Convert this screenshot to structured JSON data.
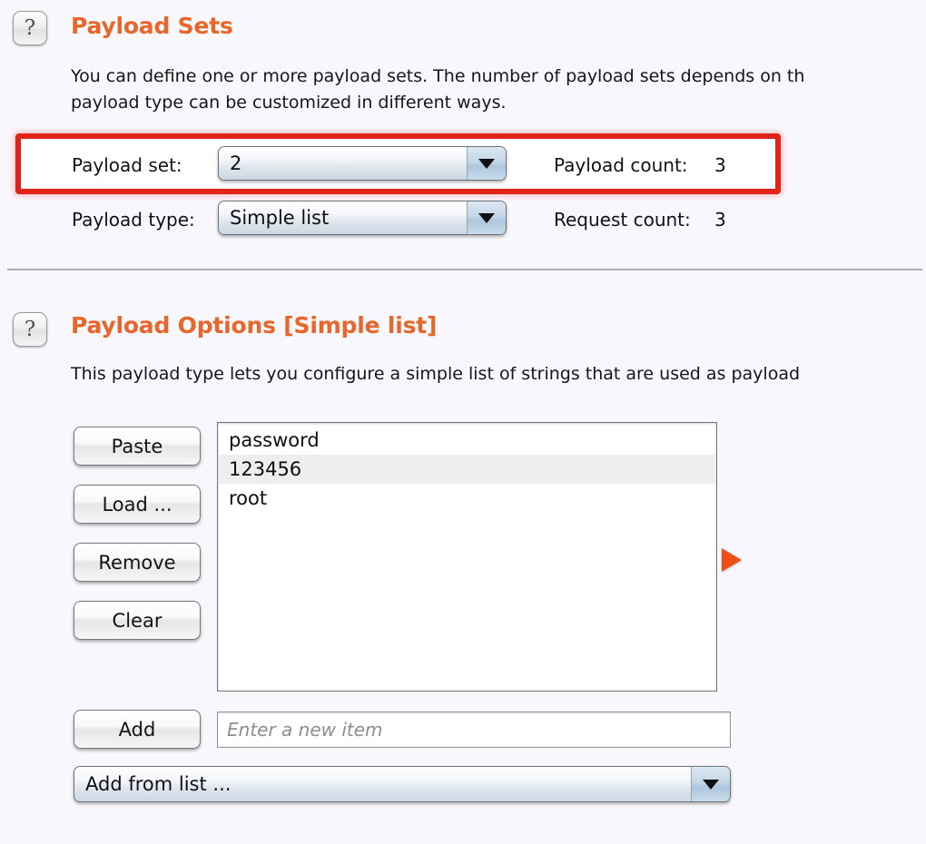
{
  "page": {
    "background": "#f8f7fb",
    "accent_color": "#e8652b",
    "annotation_color": "#e2231a"
  },
  "payload_sets": {
    "help_icon": "question-mark-icon",
    "title": "Payload Sets",
    "description_line1": "You can define one or more payload sets. The number of payload sets depends on th",
    "description_line2": "payload type can be customized in different ways.",
    "payload_set": {
      "label": "Payload set:",
      "value": "2",
      "arrow_icon": "chevron-down-icon"
    },
    "payload_type": {
      "label": "Payload type:",
      "value": "Simple list",
      "arrow_icon": "chevron-down-icon"
    },
    "payload_count": {
      "label": "Payload count:",
      "value": "3"
    },
    "request_count": {
      "label": "Request count:",
      "value": "3"
    }
  },
  "payload_options": {
    "help_icon": "question-mark-icon",
    "title": "Payload Options [Simple list]",
    "description": "This payload type lets you configure a simple list of strings that are used as payload",
    "buttons": [
      {
        "label": "Paste",
        "name": "paste-button"
      },
      {
        "label": "Load ...",
        "name": "load-button"
      },
      {
        "label": "Remove",
        "name": "remove-button"
      },
      {
        "label": "Clear",
        "name": "clear-button"
      }
    ],
    "list_items": [
      {
        "value": "password"
      },
      {
        "value": "123456"
      },
      {
        "value": "root"
      }
    ],
    "add": {
      "button_label": "Add",
      "input_value": "",
      "input_placeholder": "Enter a new item"
    },
    "add_from_list": {
      "label": "Add from list ...",
      "arrow_icon": "chevron-down-icon"
    },
    "expand_arrow_icon": "play-triangle-icon"
  }
}
